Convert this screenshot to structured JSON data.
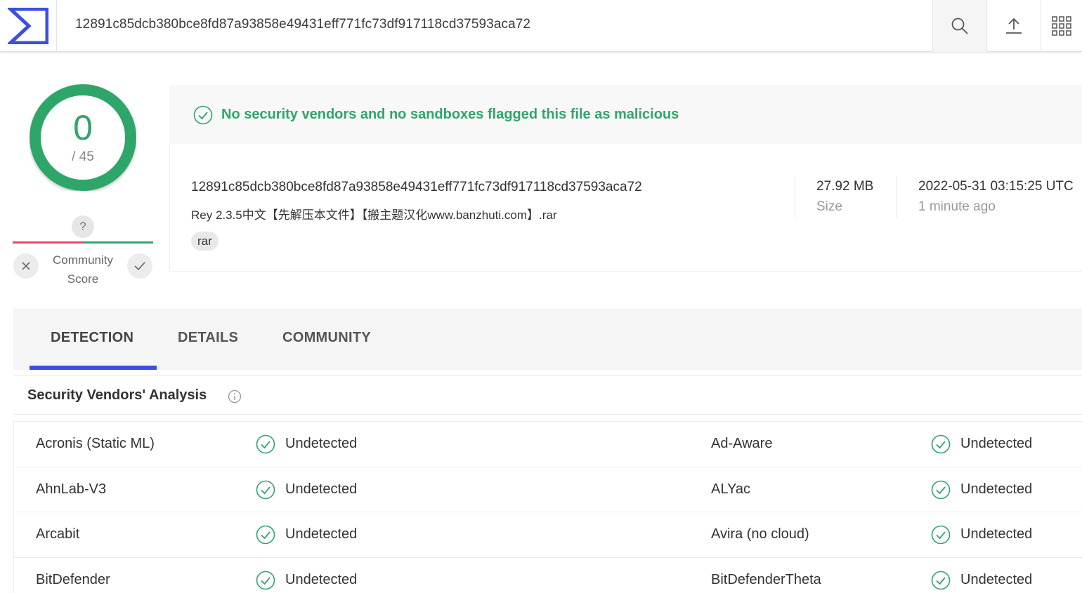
{
  "header": {
    "search_value": "12891c85dcb380bce8fd87a93858e49431eff771fc73df917118cd37593aca72",
    "icons": [
      "logo-icon",
      "search-icon",
      "upload-icon",
      "apps-grid-icon"
    ]
  },
  "score": {
    "detections": "0",
    "total": "/ 45",
    "community_question": "?",
    "community_label_line1": "Community",
    "community_label_line2": "Score"
  },
  "banner": {
    "message": "No security vendors and no sandboxes flagged this file as malicious"
  },
  "file": {
    "hash": "12891c85dcb380bce8fd87a93858e49431eff771fc73df917118cd37593aca72",
    "name": "Rey 2.3.5中文【先解压本文件】【搬主题汉化www.banzhuti.com】.rar",
    "tag": "rar",
    "size": "27.92 MB",
    "size_label": "Size",
    "date": "2022-05-31 03:15:25 UTC",
    "date_relative": "1 minute ago"
  },
  "tabs": [
    {
      "label": "DETECTION",
      "active": true
    },
    {
      "label": "DETAILS",
      "active": false
    },
    {
      "label": "COMMUNITY",
      "active": false
    }
  ],
  "analysis": {
    "title": "Security Vendors' Analysis",
    "rows": [
      {
        "left": {
          "vendor": "Acronis (Static ML)",
          "status": "Undetected"
        },
        "right": {
          "vendor": "Ad-Aware",
          "status": "Undetected"
        }
      },
      {
        "left": {
          "vendor": "AhnLab-V3",
          "status": "Undetected"
        },
        "right": {
          "vendor": "ALYac",
          "status": "Undetected"
        }
      },
      {
        "left": {
          "vendor": "Arcabit",
          "status": "Undetected"
        },
        "right": {
          "vendor": "Avira (no cloud)",
          "status": "Undetected"
        }
      },
      {
        "left": {
          "vendor": "BitDefender",
          "status": "Undetected"
        },
        "right": {
          "vendor": "BitDefenderTheta",
          "status": "Undetected"
        }
      }
    ]
  },
  "colors": {
    "accent": "#3b4fe0",
    "clean": "#2fa66a",
    "negative": "#e84866"
  }
}
